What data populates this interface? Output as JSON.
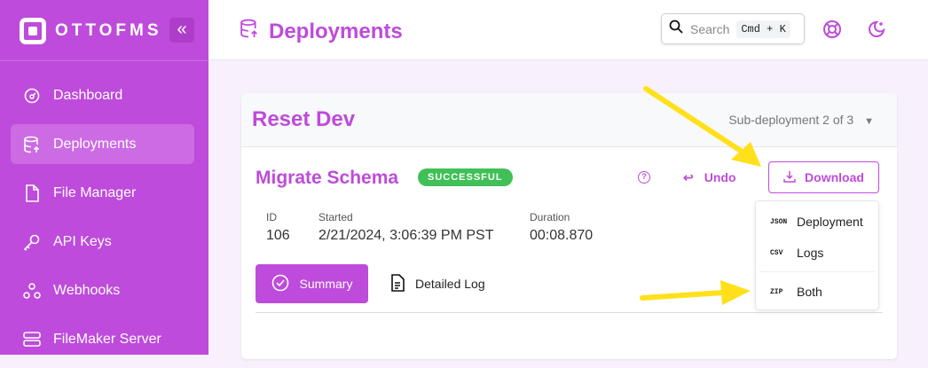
{
  "sidebar": {
    "brand": "OTTOFMS",
    "items": [
      {
        "label": "Dashboard",
        "icon": "gauge-icon"
      },
      {
        "label": "Deployments",
        "icon": "database-icon",
        "active": true
      },
      {
        "label": "File Manager",
        "icon": "file-icon"
      },
      {
        "label": "API Keys",
        "icon": "key-icon"
      },
      {
        "label": "Webhooks",
        "icon": "webhook-icon"
      },
      {
        "label": "FileMaker Server",
        "icon": "server-icon"
      }
    ]
  },
  "header": {
    "title": "Deployments",
    "search_placeholder": "Search",
    "shortcut": "Cmd + K"
  },
  "card": {
    "title": "Reset Dev",
    "subdeployment": "Sub-deployment 2 of 3",
    "step_title": "Migrate Schema",
    "status": "SUCCESSFUL",
    "undo": "Undo",
    "download": "Download",
    "meta": {
      "id_label": "ID",
      "id": "106",
      "started_label": "Started",
      "started": "2/21/2024, 3:06:39 PM PST",
      "duration_label": "Duration",
      "duration": "00:08.870"
    },
    "tabs": {
      "summary": "Summary",
      "log": "Detailed Log"
    }
  },
  "download_menu": [
    {
      "code": "JSON",
      "label": "Deployment"
    },
    {
      "code": "CSV",
      "label": "Logs"
    },
    {
      "code": "ZIP",
      "label": "Both"
    }
  ],
  "colors": {
    "brand": "#be4bdb",
    "success": "#40c057",
    "arrow": "#ffe01b"
  }
}
